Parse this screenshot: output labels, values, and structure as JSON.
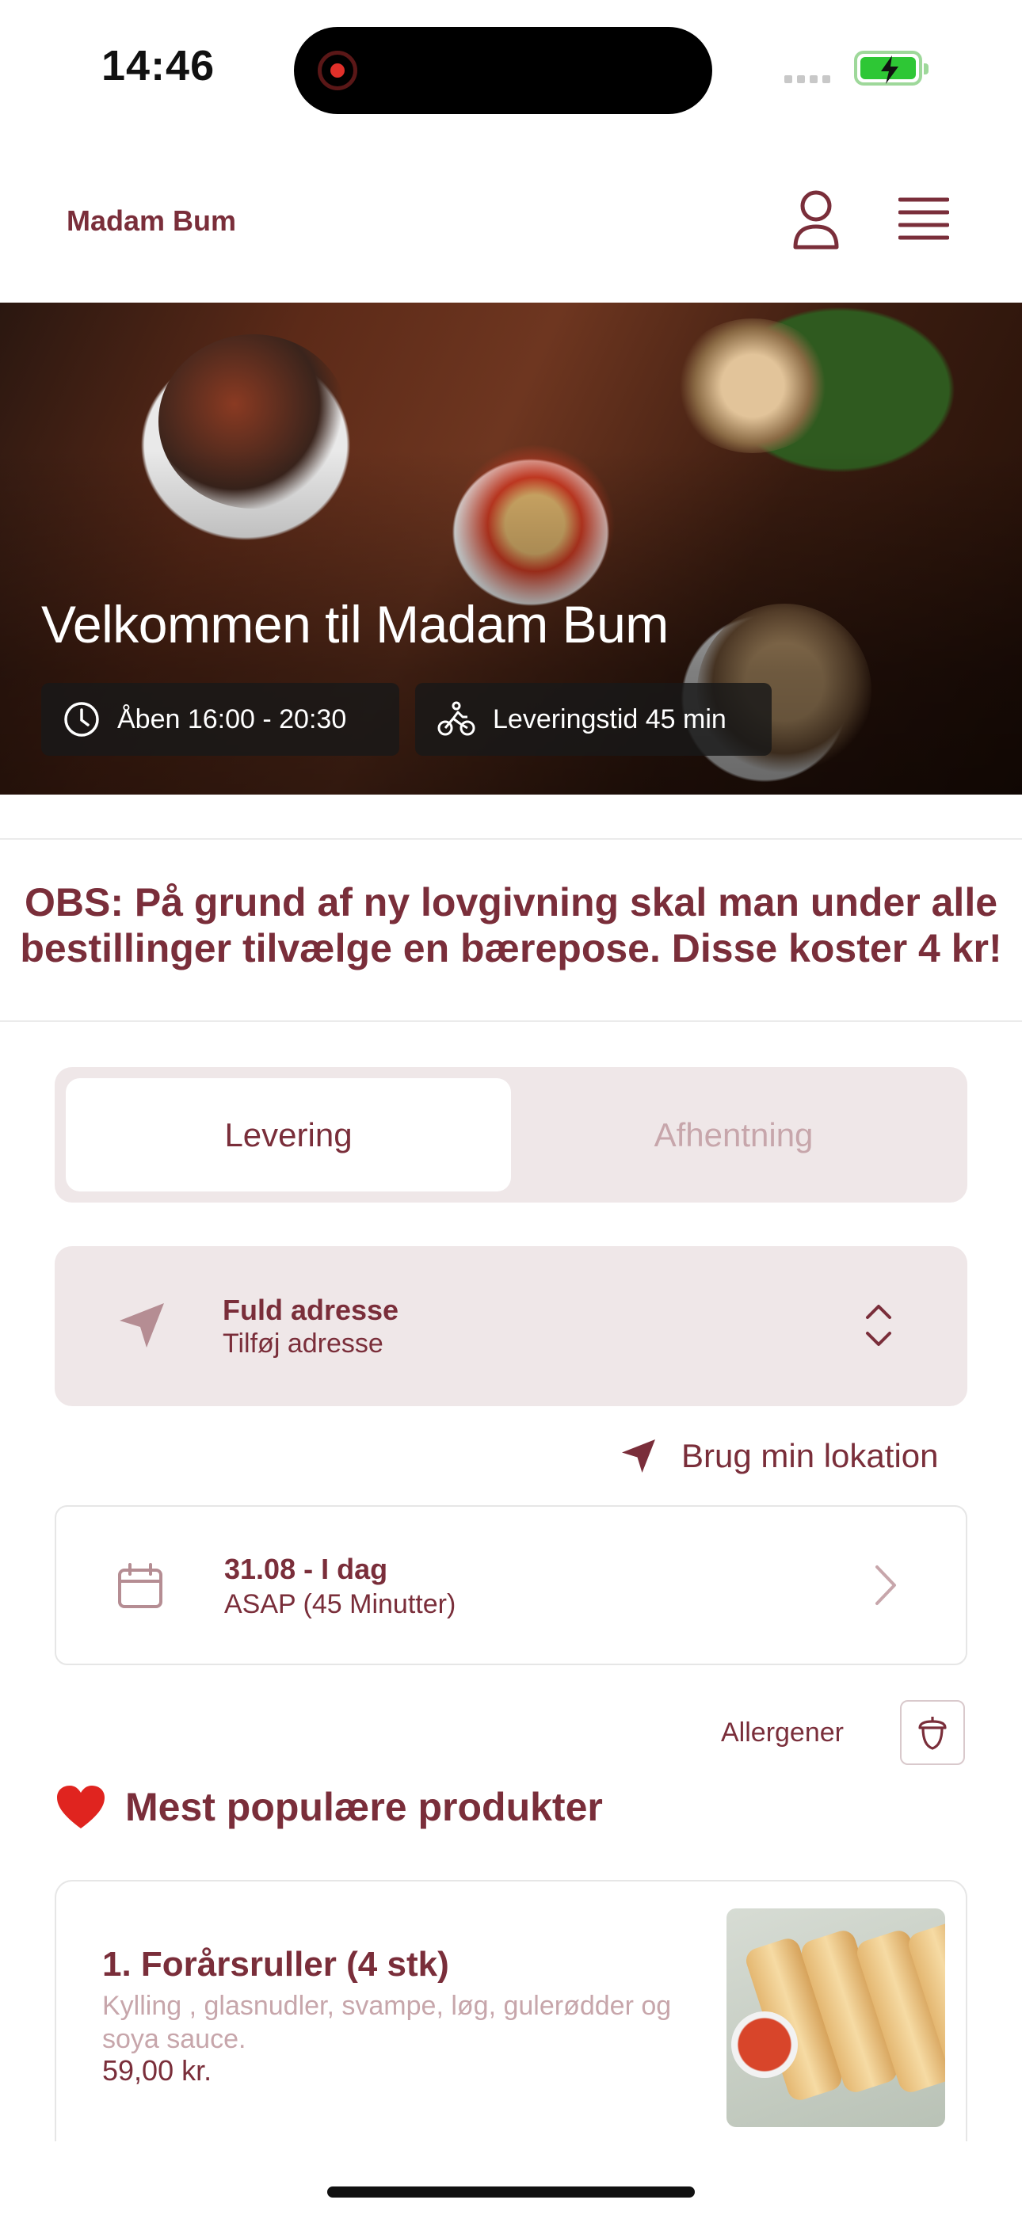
{
  "status_bar": {
    "time": "14:46"
  },
  "header": {
    "brand": "Madam Bum"
  },
  "hero": {
    "title": "Velkommen til Madam Bum",
    "opening_hours": "Åben 16:00 - 20:30",
    "delivery_time": "Leveringstid 45 min"
  },
  "notice": {
    "line1": "OBS: På grund af ny lovgivning skal man under alle",
    "line2": "bestillinger tilvælge en bærepose. Disse koster 4 kr!"
  },
  "order_type": {
    "delivery_label": "Levering",
    "pickup_label": "Afhentning",
    "selected": "Levering"
  },
  "address": {
    "title": "Fuld adresse",
    "placeholder": "Tilføj adresse",
    "use_location_label": "Brug min lokation"
  },
  "schedule": {
    "date_label": "31.08 - I dag",
    "time_label": "ASAP (45 Minutter)"
  },
  "allergens": {
    "label": "Allergener"
  },
  "popular": {
    "heading": "Mest populære produkter",
    "products": [
      {
        "name": "1. Forårsruller (4 stk)",
        "description": "Kylling , glasnudler, svampe, løg, gulerødder og soya sauce.",
        "price": "59,00 kr."
      }
    ]
  },
  "colors": {
    "brand": "#7a2e3a",
    "muted": "#c7a6ab",
    "panel": "#efe7e8"
  }
}
